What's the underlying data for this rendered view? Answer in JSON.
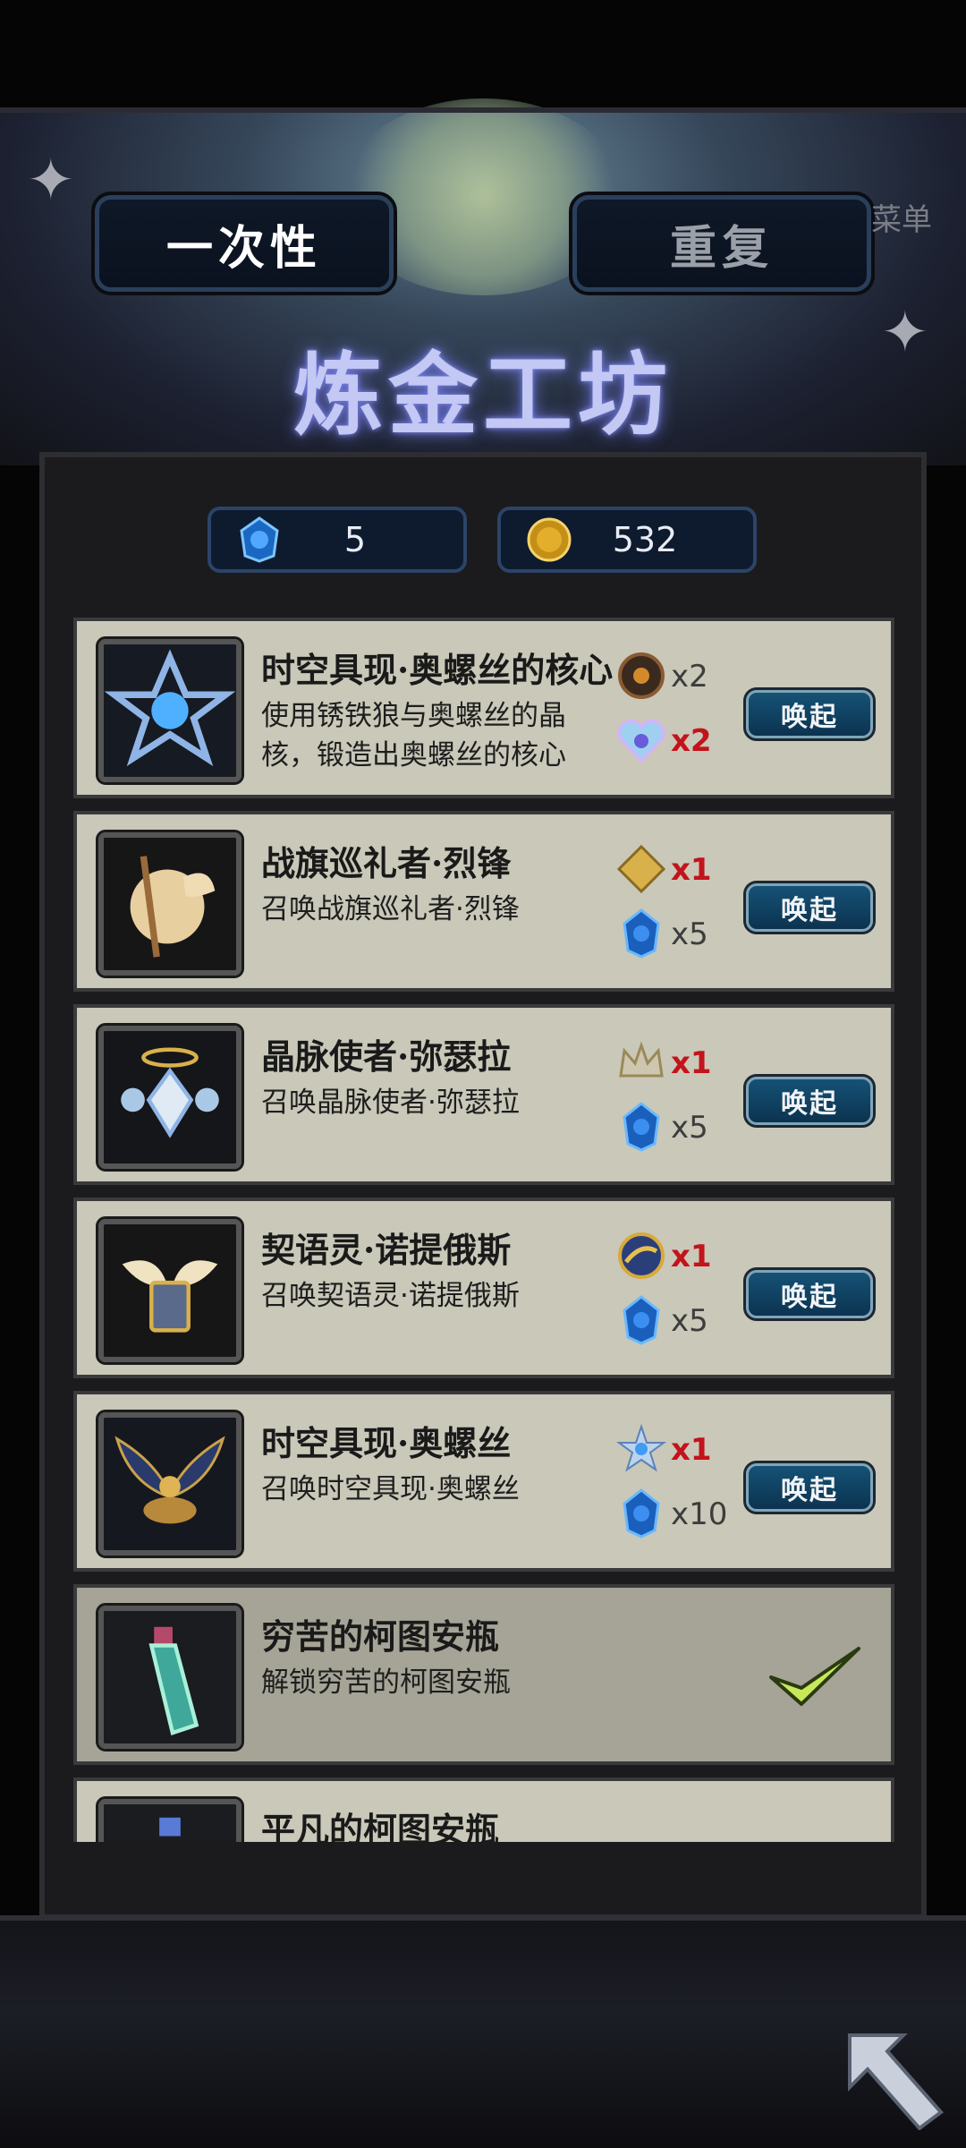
{
  "tabs": {
    "one_time": "一次性",
    "repeat": "重复"
  },
  "menu_tag": "菜单",
  "title": "炼金工坊",
  "currency": [
    {
      "icon": "blue-crystal-icon",
      "value": "5"
    },
    {
      "icon": "gold-coin-icon",
      "value": "532"
    }
  ],
  "summon_label": "唤起",
  "recipes": [
    {
      "name": "时空具现·奥螺丝的核心",
      "desc": "使用锈铁狼与奥螺丝的晶核，锻造出奥螺丝的核心",
      "icon": "star-core-icon",
      "reqs": [
        {
          "icon": "rust-gear-icon",
          "qty": "x2",
          "color": "gray"
        },
        {
          "icon": "crystal-heart-icon",
          "qty": "x2",
          "color": "red"
        }
      ],
      "done": false
    },
    {
      "name": "战旗巡礼者·烈锋",
      "desc": "召唤战旗巡礼者·烈锋",
      "icon": "banner-pilgrim-icon",
      "reqs": [
        {
          "icon": "gold-diamond-icon",
          "qty": "x1",
          "color": "red"
        },
        {
          "icon": "blue-crystal-icon",
          "qty": "x5",
          "color": "gray"
        }
      ],
      "done": false
    },
    {
      "name": "晶脉使者·弥瑟拉",
      "desc": "召唤晶脉使者·弥瑟拉",
      "icon": "crystal-envoy-icon",
      "reqs": [
        {
          "icon": "crystal-crown-icon",
          "qty": "x1",
          "color": "red"
        },
        {
          "icon": "blue-crystal-icon",
          "qty": "x5",
          "color": "gray"
        }
      ],
      "done": false
    },
    {
      "name": "契语灵·诺提俄斯",
      "desc": "召唤契语灵·诺提俄斯",
      "icon": "spirit-book-icon",
      "reqs": [
        {
          "icon": "gold-orb-icon",
          "qty": "x1",
          "color": "red"
        },
        {
          "icon": "blue-crystal-icon",
          "qty": "x5",
          "color": "gray"
        }
      ],
      "done": false
    },
    {
      "name": "时空具现·奥螺丝",
      "desc": "召唤时空具现·奥螺丝",
      "icon": "winged-relic-icon",
      "reqs": [
        {
          "icon": "star-core-icon",
          "qty": "x1",
          "color": "red"
        },
        {
          "icon": "blue-crystal-icon",
          "qty": "x10",
          "color": "gray"
        }
      ],
      "done": false
    },
    {
      "name": "穷苦的柯图安瓶",
      "desc": "解锁穷苦的柯图安瓶",
      "icon": "potion-bottle-icon",
      "reqs": [],
      "done": true
    },
    {
      "name": "平凡的柯图安瓶",
      "desc": "",
      "icon": "potion-bottle-icon",
      "reqs": [],
      "done": false
    }
  ]
}
